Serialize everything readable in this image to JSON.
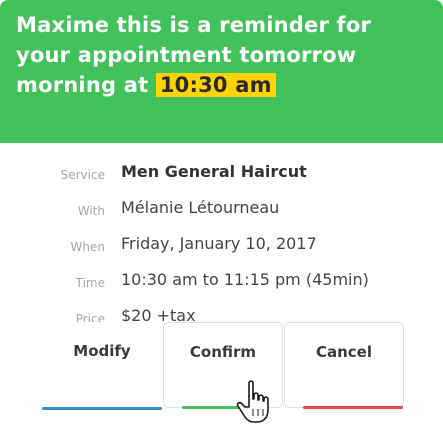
{
  "reminder": {
    "text_before": "Maxime this is a reminder for your appointment tomorrow morning at",
    "time_highlight": "10:30 am"
  },
  "details": {
    "service": {
      "label": "Service",
      "value": "Men General Haircut"
    },
    "with": {
      "label": "With",
      "value": "Mélanie Létourneau"
    },
    "when": {
      "label": "When",
      "value": "Friday, January 10, 2017"
    },
    "time": {
      "label": "Time",
      "value": "10:30 am to 11:15 pm (45min)"
    },
    "price": {
      "label": "Price",
      "value": "$20 +tax"
    }
  },
  "actions": {
    "modify_label": "Modify",
    "confirm_label": "Confirm",
    "cancel_label": "Cancel"
  },
  "colors": {
    "header_bg": "#43c15a",
    "highlight": "#ffd400",
    "modify_accent": "#2f8fd6",
    "confirm_accent": "#43c15a",
    "cancel_accent": "#e64a4a"
  },
  "icons": {
    "cursor": "hand-pointer-icon"
  }
}
